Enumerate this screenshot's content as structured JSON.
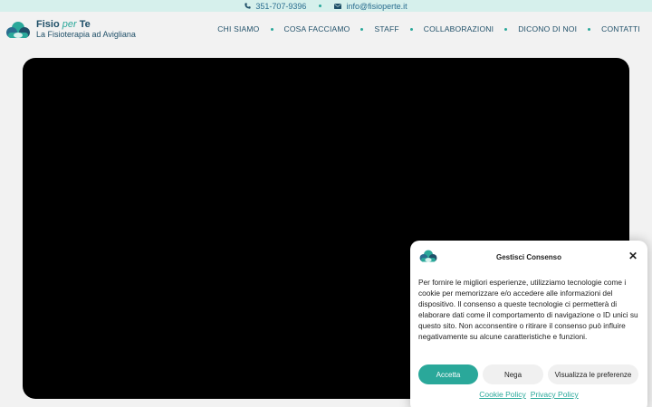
{
  "topbar": {
    "phone": "351-707-9396",
    "email": "info@fisioperte.it",
    "phone_icon": "phone-icon",
    "email_icon": "envelope-icon"
  },
  "brand": {
    "name_start": "Fisio",
    "name_mid": "per",
    "name_end": "Te",
    "tagline": "La Fisioterapia ad Avigliana",
    "logo_icon": "cloud-logo"
  },
  "nav": {
    "items": [
      "CHI SIAMO",
      "COSA FACCIAMO",
      "STAFF",
      "COLLABORAZIONI",
      "DICONO DI NOI",
      "CONTATTI"
    ]
  },
  "cookie": {
    "title": "Gestisci Consenso",
    "text": "Per fornire le migliori esperienze, utilizziamo tecnologie come i cookie per memorizzare e/o accedere alle informazioni del dispositivo. Il consenso a queste tecnologie ci permetterà di elaborare dati come il comportamento di navigazione o ID unici su questo sito. Non acconsentire o ritirare il consenso può influire negativamente su alcune caratteristiche e funzioni.",
    "accept_label": "Accetta",
    "deny_label": "Nega",
    "prefs_label": "Visualizza le preferenze",
    "cookie_policy": "Cookie Policy",
    "privacy_policy": "Privacy Policy",
    "close_icon": "close-icon"
  },
  "colors": {
    "accent": "#2aa89a",
    "brand_dark": "#1f4f68",
    "topbar_bg": "#d6f0ec",
    "page_bg": "#f2f2f2"
  }
}
